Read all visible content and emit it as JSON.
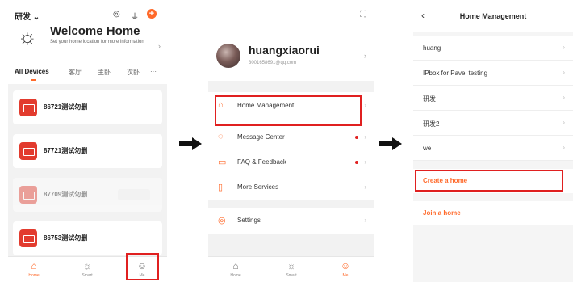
{
  "panel1": {
    "home_name": "研发 ⌄",
    "top_icons": [
      "record-icon",
      "mic-icon",
      "plus-icon"
    ],
    "plus_glyph": "+",
    "welcome_title": "Welcome Home",
    "welcome_sub": "Set your home location for more information",
    "chevron": "›",
    "tabs": [
      "All Devices",
      "客厅",
      "主卧",
      "次卧"
    ],
    "more": "···",
    "devices": [
      {
        "name": "86721测试勿删",
        "offline": false
      },
      {
        "name": "87721测试勿删",
        "offline": false
      },
      {
        "name": "87709测试勿删",
        "offline": true
      },
      {
        "name": "86753测试勿删",
        "offline": false
      }
    ],
    "tabbar": [
      {
        "label": "Home",
        "glyph": "⌂",
        "icon": "home-icon"
      },
      {
        "label": "Smart",
        "glyph": "☼",
        "icon": "smart-icon"
      },
      {
        "label": "Me",
        "glyph": "☺",
        "icon": "me-icon"
      }
    ]
  },
  "panel2": {
    "scan_glyph": "⛶",
    "username": "huangxiaorui",
    "email": "3001658691@qq.com",
    "chevron": "›",
    "menu": [
      {
        "label": "Home Management",
        "glyph": "⌂",
        "dot": false
      },
      {
        "label": "Message Center",
        "glyph": "◌",
        "dot": true
      },
      {
        "label": "FAQ & Feedback",
        "glyph": "▭",
        "dot": true
      },
      {
        "label": "More Services",
        "glyph": "▯",
        "dot": false
      }
    ],
    "settings": {
      "label": "Settings",
      "glyph": "◎"
    },
    "tabbar": [
      {
        "label": "Home",
        "glyph": "⌂",
        "icon": "home-icon"
      },
      {
        "label": "Smart",
        "glyph": "☼",
        "icon": "smart-icon"
      },
      {
        "label": "Me",
        "glyph": "☺",
        "icon": "me-icon"
      }
    ]
  },
  "panel3": {
    "back_glyph": "‹",
    "title": "Home Management",
    "homes": [
      "huang",
      "IPbox for Pavel testing",
      "研发",
      "研发2",
      "we"
    ],
    "chevron": "›",
    "create": "Create a home",
    "join": "Join a home"
  },
  "colors": {
    "accent": "#ff6a2b",
    "highlight": "#e02020"
  }
}
